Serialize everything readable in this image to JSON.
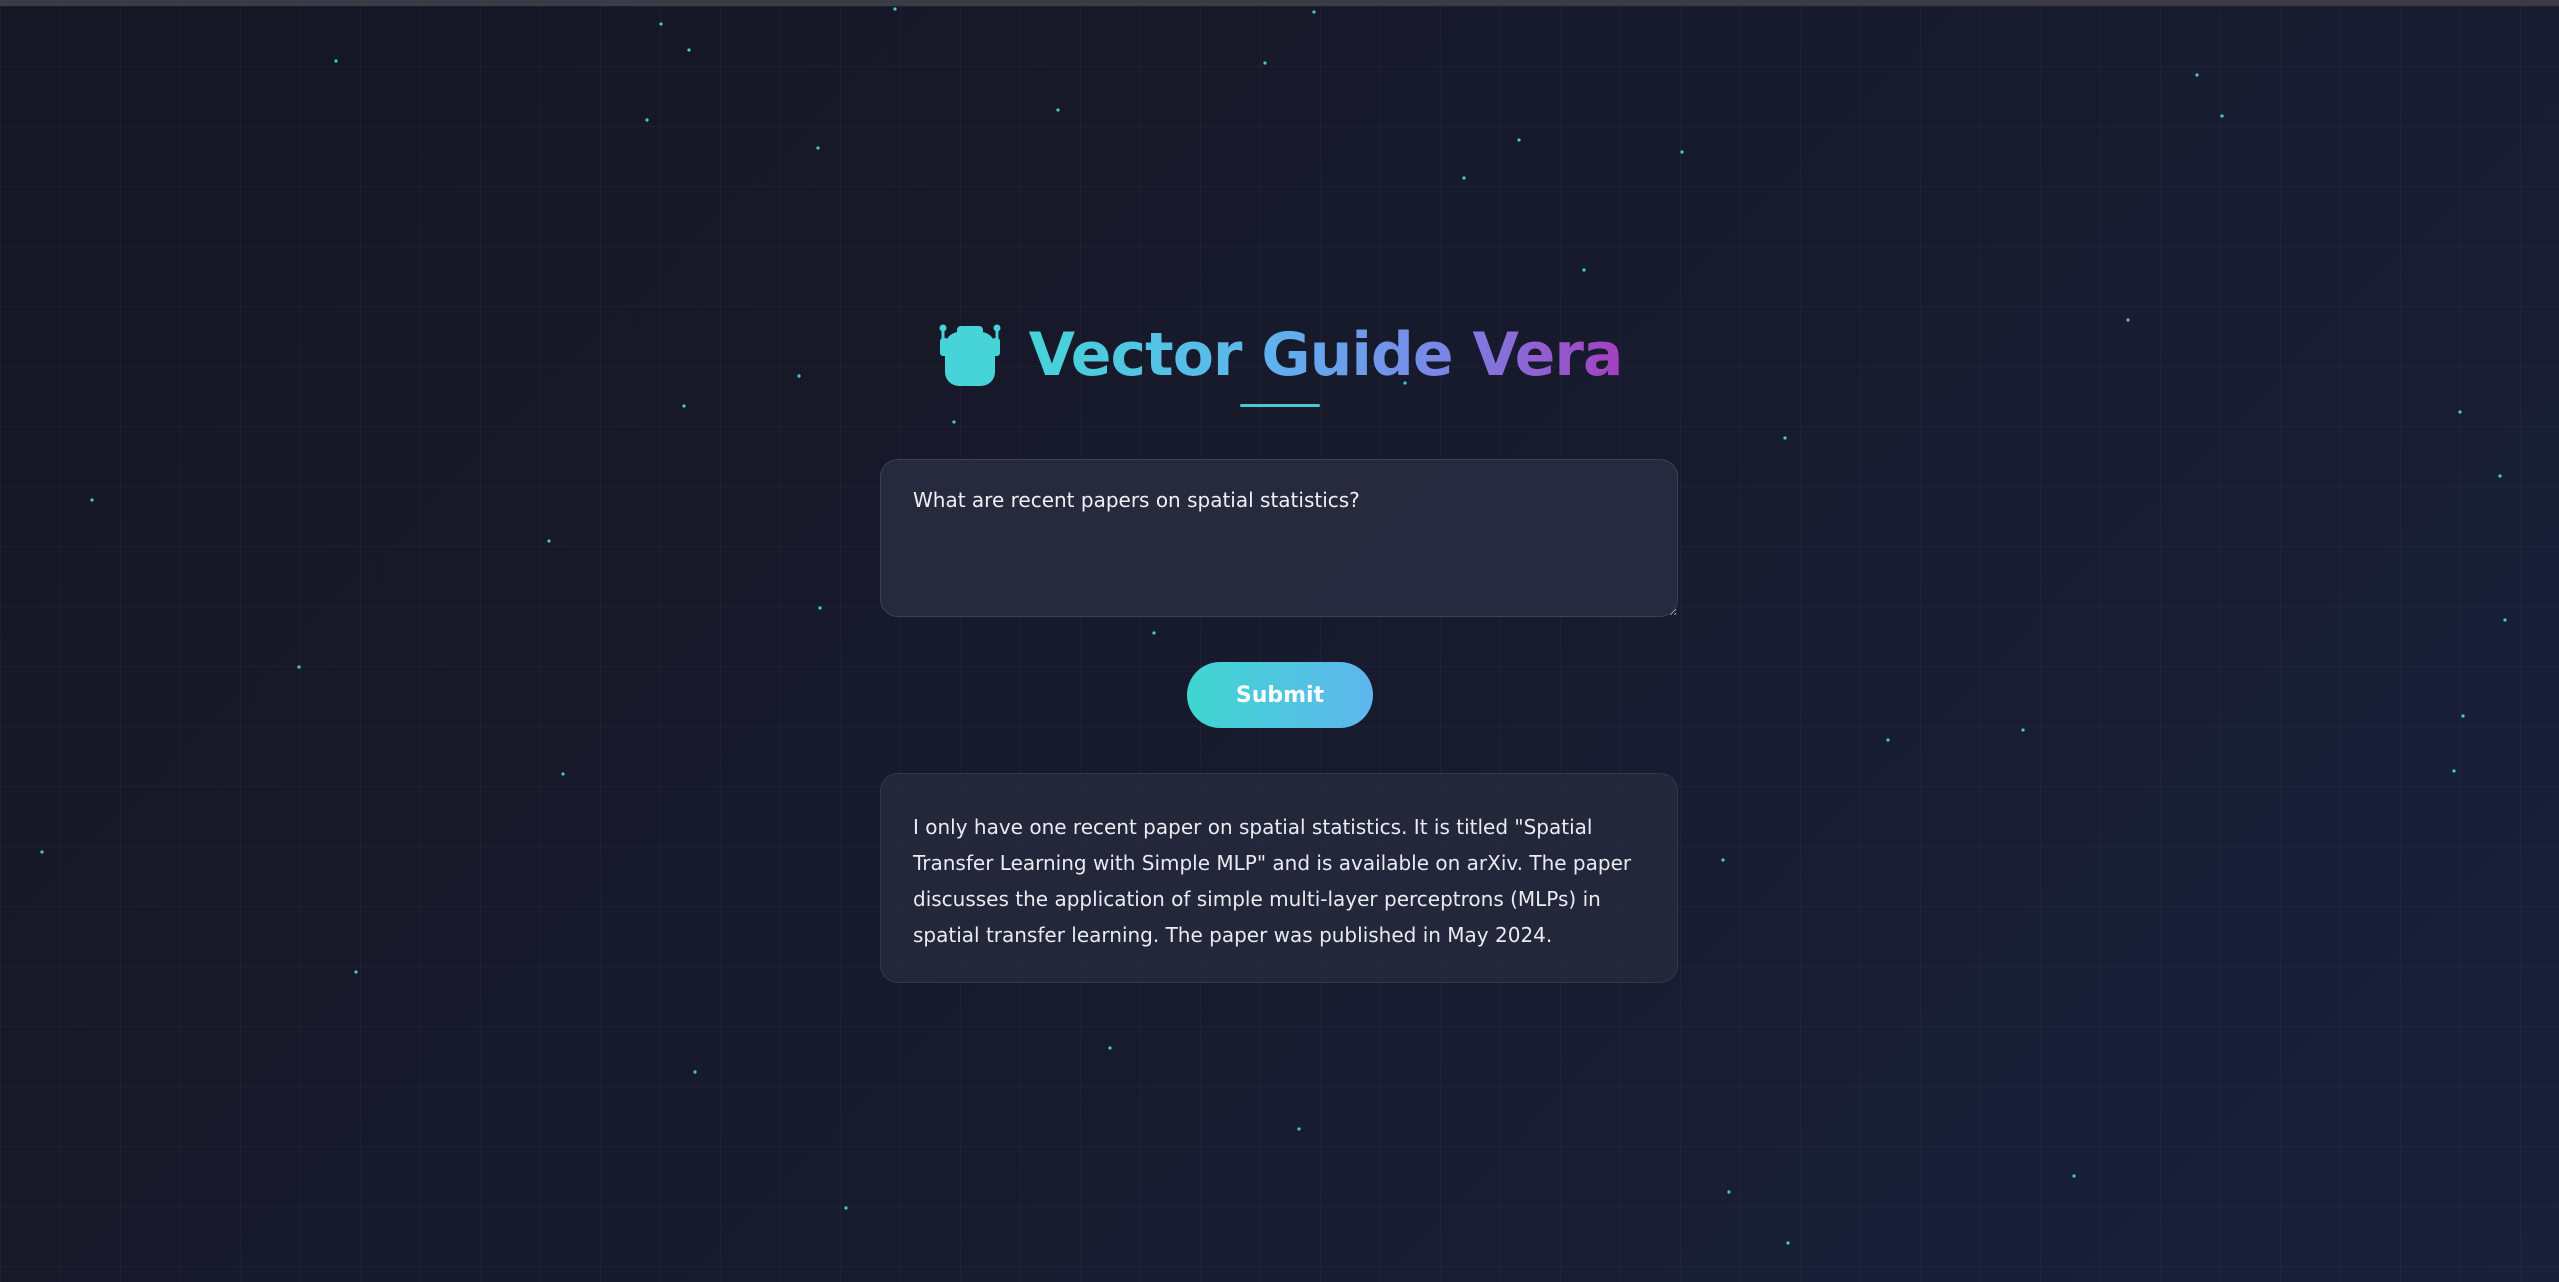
{
  "app": {
    "title": "Vector Guide Vera",
    "logo_icon": "robot-icon"
  },
  "query": {
    "value": "What are recent papers on spatial statistics?"
  },
  "submit": {
    "label": "Submit"
  },
  "answer": {
    "text": "I only have one recent paper on spatial statistics. It is titled \"Spatial Transfer Learning with Simple MLP\" and is available on arXiv. The paper discusses the application of simple multi-layer perceptrons (MLPs) in spatial transfer learning. The paper was published in May 2024."
  },
  "colors": {
    "accent_teal": "#46d4d8",
    "accent_blue": "#5fb3ee",
    "accent_purple": "#a43fc0",
    "background": "#161624"
  }
}
